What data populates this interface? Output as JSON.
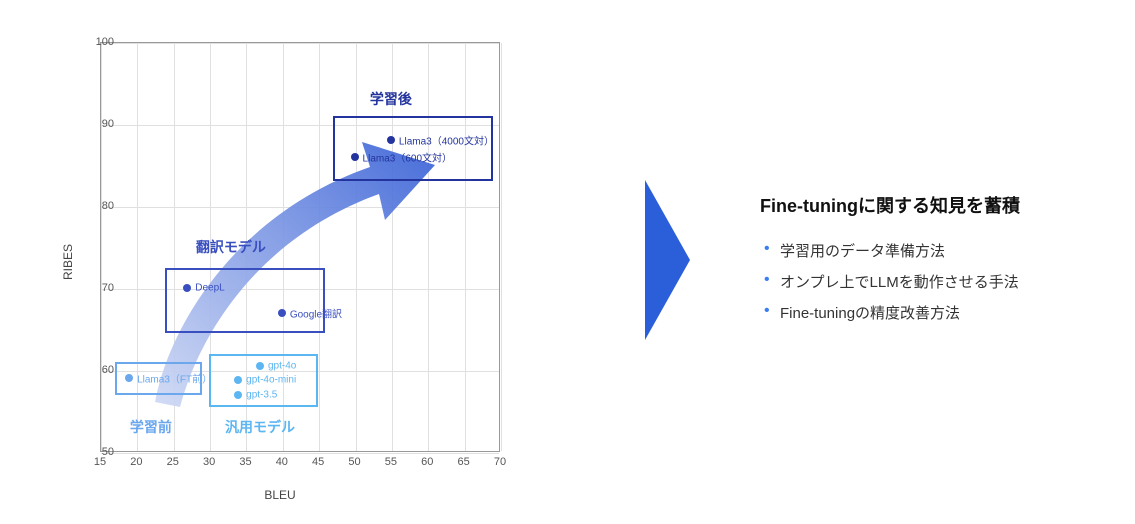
{
  "chart_data": {
    "type": "scatter",
    "xlabel": "BLEU",
    "ylabel": "RIBES",
    "xlim": [
      15,
      70
    ],
    "ylim": [
      50,
      100
    ],
    "xticks": [
      15,
      20,
      25,
      30,
      35,
      40,
      45,
      50,
      55,
      60,
      65,
      70
    ],
    "yticks": [
      50,
      60,
      70,
      80,
      90,
      100
    ],
    "series": [
      {
        "name": "学習後",
        "color": "#23349e",
        "points": [
          {
            "x": 55,
            "y": 88,
            "label": "Llama3（4000文対）"
          },
          {
            "x": 50,
            "y": 86,
            "label": "Llama3（600文対）"
          }
        ],
        "box": {
          "x1": 47,
          "y1": 83,
          "x2": 69,
          "y2": 91
        }
      },
      {
        "name": "翻訳モデル",
        "color": "#3a4fbf",
        "points": [
          {
            "x": 27,
            "y": 70,
            "label": "DeepL"
          },
          {
            "x": 40,
            "y": 67,
            "label": "Google翻訳"
          }
        ],
        "box": {
          "x1": 24,
          "y1": 64.5,
          "x2": 46,
          "y2": 72.5
        }
      },
      {
        "name": "汎用モデル",
        "color": "#5cb6f2",
        "points": [
          {
            "x": 37,
            "y": 60.5,
            "label": "gpt-4o"
          },
          {
            "x": 34,
            "y": 58.8,
            "label": "gpt-4o-mini"
          },
          {
            "x": 34,
            "y": 57,
            "label": "gpt-3.5"
          }
        ],
        "box": {
          "x1": 30,
          "y1": 55.5,
          "x2": 45,
          "y2": 62
        }
      },
      {
        "name": "学習前",
        "color": "#6aa7ed",
        "points": [
          {
            "x": 19,
            "y": 59,
            "label": "Llama3（FT前）"
          }
        ],
        "box": {
          "x1": 17,
          "y1": 57,
          "x2": 29,
          "y2": 61
        }
      }
    ],
    "group_titles": [
      {
        "text": "学習後",
        "x": 55,
        "y": 93,
        "color": "#23349e"
      },
      {
        "text": "翻訳モデル",
        "x": 33,
        "y": 75,
        "color": "#3a4fbf"
      },
      {
        "text": "汎用モデル",
        "x": 37,
        "y": 53,
        "color": "#5cb6f2"
      },
      {
        "text": "学習前",
        "x": 22,
        "y": 53,
        "color": "#6aa7ed"
      }
    ]
  },
  "right_panel": {
    "title": "Fine-tuningに関する知見を蓄積",
    "bullets": [
      "学習用のデータ準備方法",
      "オンプレ上でLLMを動作させる手法",
      "Fine-tuningの精度改善方法"
    ]
  }
}
